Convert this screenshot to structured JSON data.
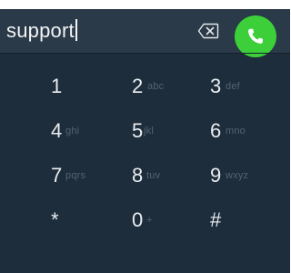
{
  "input": {
    "value": "support"
  },
  "icons": {
    "backspace": "backspace-icon",
    "call": "phone-icon"
  },
  "colors": {
    "background": "#1e2d3b",
    "input_bar": "#2b3a48",
    "call_button": "#3ccf3a",
    "digit": "#e9edf1",
    "letters": "#56636f"
  },
  "keypad": {
    "keys": [
      {
        "digit": "1",
        "letters": ""
      },
      {
        "digit": "2",
        "letters": "abc"
      },
      {
        "digit": "3",
        "letters": "def"
      },
      {
        "digit": "4",
        "letters": "ghi"
      },
      {
        "digit": "5",
        "letters": "jkl"
      },
      {
        "digit": "6",
        "letters": "mno"
      },
      {
        "digit": "7",
        "letters": "pqrs"
      },
      {
        "digit": "8",
        "letters": "tuv"
      },
      {
        "digit": "9",
        "letters": "wxyz"
      },
      {
        "digit": "*",
        "letters": ""
      },
      {
        "digit": "0",
        "letters": "+"
      },
      {
        "digit": "#",
        "letters": ""
      }
    ]
  }
}
